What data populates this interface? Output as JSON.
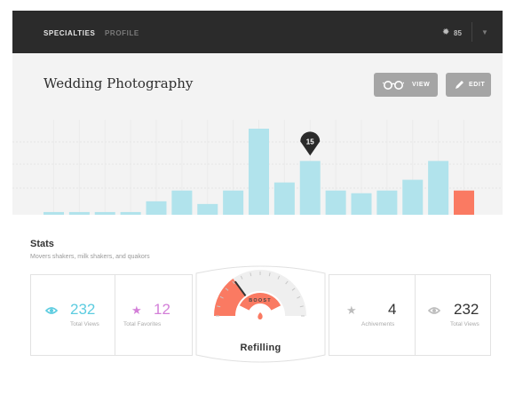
{
  "nav": {
    "active": "SPECIALTIES",
    "inactive": "PROFILE",
    "stat_icon": "sun-icon",
    "stat_count": "85",
    "menu_icon": "caret-down-icon"
  },
  "header": {
    "title": "Wedding Photography",
    "view_label": "VIEW",
    "edit_label": "EDIT",
    "view_icon": "glasses-icon",
    "edit_icon": "pencil-icon"
  },
  "chart_data": {
    "type": "bar",
    "values": [
      1,
      1,
      1,
      1,
      5,
      9,
      4,
      9,
      32,
      12,
      20,
      9,
      8,
      9,
      13,
      20,
      9
    ],
    "highlight_color": "#fa7a62",
    "bar_color": "#b1e3ec",
    "highlight_index": 16,
    "marker_index": 10,
    "marker_label": "15",
    "tabs": [
      {
        "index": 8,
        "icon": "flame-icon"
      },
      {
        "index": 13,
        "icon": "bird-icon"
      },
      {
        "index": 15,
        "icon": "pencil-icon"
      }
    ]
  },
  "stats": {
    "title": "Stats",
    "subtitle": "Movers shakers, milk shakers, and quakors",
    "items": [
      {
        "value": "232",
        "label": "Total Views",
        "icon": "eye-icon",
        "color": "#5ccce0"
      },
      {
        "value": "12",
        "label": "Total Favorites",
        "icon": "star-icon",
        "color": "#d37fd8"
      },
      {
        "value": "4",
        "label": "Achivements",
        "icon": "star-icon",
        "color": "#333333"
      },
      {
        "value": "232",
        "label": "Total Views",
        "icon": "eye-icon",
        "color": "#333333"
      }
    ],
    "gauge": {
      "label": "Refilling",
      "boost": "BOOST",
      "level": 0.3,
      "color": "#fa7a62"
    }
  }
}
